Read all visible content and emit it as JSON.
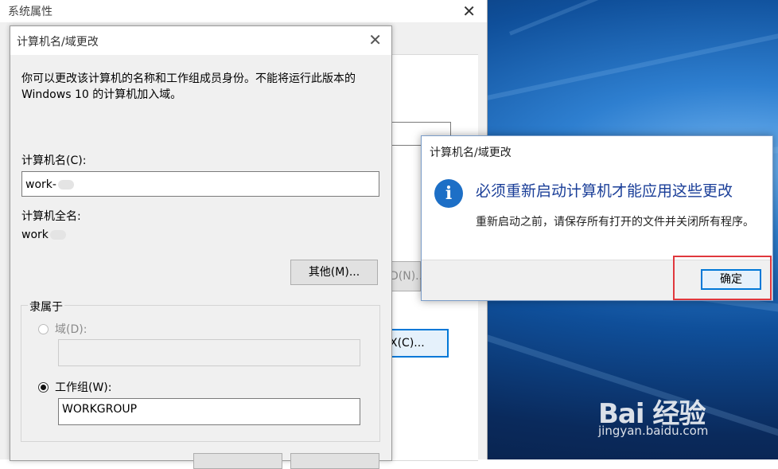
{
  "sysprops": {
    "title": "系统属性",
    "close_glyph": "✕",
    "partial_button_n": "D(N)...",
    "partial_button_c": "X(C)..."
  },
  "name_dialog": {
    "title": "计算机名/域更改",
    "close_glyph": "✕",
    "description": "你可以更改该计算机的名称和工作组成员身份。不能将运行此版本的 Windows 10 的计算机加入域。",
    "computer_name_label": "计算机名(C):",
    "computer_name_value": "work-",
    "full_name_label": "计算机全名:",
    "full_name_value": "work",
    "more_button": "其他(M)...",
    "member_of_label": "隶属于",
    "domain_label": "域(D):",
    "domain_value": "",
    "workgroup_label": "工作组(W):",
    "workgroup_value": "WORKGROUP"
  },
  "msgbox": {
    "title": "计算机名/域更改",
    "icon": "info-icon",
    "heading": "必须重新启动计算机才能应用这些更改",
    "body": "重新启动之前，请保存所有打开的文件并关闭所有程序。",
    "ok_button": "确定"
  },
  "watermark": {
    "brand": "Bai  经验",
    "url": "jingyan.baidu.com"
  },
  "colors": {
    "accent": "#0078d7",
    "highlight": "#e0383d",
    "heading_text": "#1a3e98"
  }
}
